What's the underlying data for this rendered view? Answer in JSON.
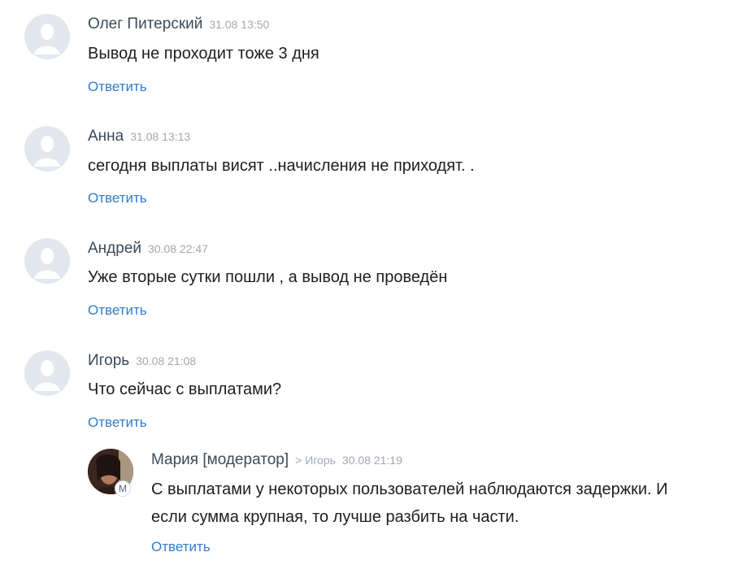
{
  "comments": [
    {
      "author": "Олег Питерский",
      "date": "31.08 13:50",
      "text": "Вывод не проходит тоже 3 дня",
      "reply_label": "Ответить",
      "avatar_icon": "default-user-icon"
    },
    {
      "author": "Анна",
      "date": "31.08 13:13",
      "text": "сегодня выплаты висят ..начисления не приходят. .",
      "reply_label": "Ответить",
      "avatar_icon": "default-user-icon"
    },
    {
      "author": "Андрей",
      "date": "30.08 22:47",
      "text": "Уже вторые сутки пошли , а вывод не проведён",
      "reply_label": "Ответить",
      "avatar_icon": "default-user-icon"
    },
    {
      "author": "Игорь",
      "date": "30.08 21:08",
      "text": "Что сейчас с выплатами?",
      "reply_label": "Ответить",
      "avatar_icon": "default-user-icon"
    }
  ],
  "reply": {
    "author": "Мария [модератор]",
    "reply_to": "> Игорь",
    "date": "30.08 21:19",
    "text_line1": "С выплатами у некоторых пользователей наблюдаются задержки. И",
    "text_line2": "если сумма крупная, то лучше разбить на части.",
    "reply_label": "Ответить",
    "badge": "M",
    "avatar_icon": "user-photo"
  },
  "colors": {
    "link": "#2f7dc8",
    "meta": "#a3a8b0",
    "author": "#3b4a5a"
  }
}
